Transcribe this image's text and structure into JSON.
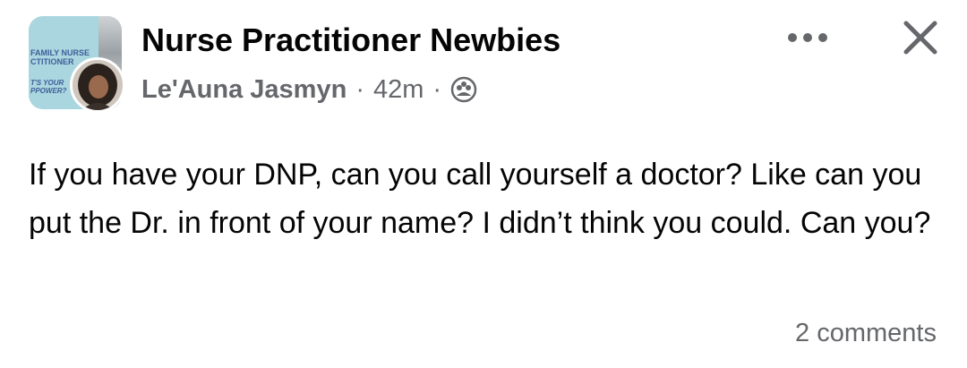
{
  "post": {
    "group_name": "Nurse Practitioner Newbies",
    "group_avatar_text": [
      "FAMILY NURSE",
      "CTITIONER",
      "T'S YOUR",
      "PPOWER?"
    ],
    "author": "Le'Auna Jasmyn",
    "separator": "·",
    "time": "42m",
    "audience_icon": "group-audience-icon",
    "more_icon": "more-options-icon",
    "close_icon": "close-icon",
    "body": "If you have your DNP, can you call yourself a doctor? Like can you put the Dr. in front of your name? I didn’t think you could. Can you?",
    "comments": "2 comments"
  },
  "colors": {
    "text_primary": "#050505",
    "text_secondary": "#65676b",
    "avatar_bg": "#a9d6df"
  }
}
